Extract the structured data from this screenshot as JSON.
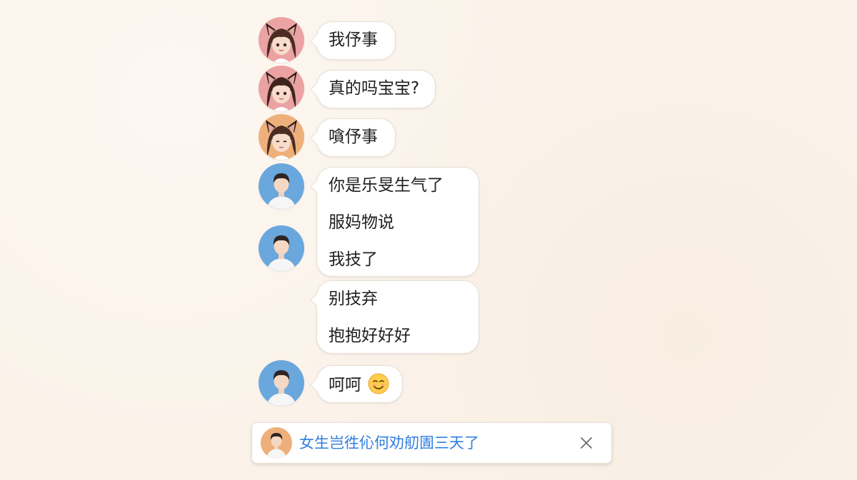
{
  "messages": [
    {
      "sender": "girl-pink",
      "lines": [
        "我伃事"
      ]
    },
    {
      "sender": "girl-pink",
      "lines": [
        "真的吗宝宝?"
      ]
    },
    {
      "sender": "girl-orange",
      "lines": [
        "嗿伃事"
      ]
    },
    {
      "sender": "boy",
      "lines": [
        "你是乐旻生气了",
        "服妈物说",
        "我技了"
      ]
    },
    {
      "sender": "boy",
      "lines": [
        "别技弃",
        "抱抱好好好"
      ]
    },
    {
      "sender": "boy",
      "lines": [
        "呵呵"
      ],
      "emoji": "smiling-face-emoji"
    }
  ],
  "notification": {
    "text": "女生岂徃伈何劝舠圊三天了",
    "icon": "close-icon"
  },
  "colors": {
    "background": "#fbf3ea",
    "bubble": "#ffffff",
    "notification_text": "#2f7de0",
    "avatar_pink": "#eba2a2",
    "avatar_orange": "#eeb07a",
    "avatar_blue": "#6aa7dd"
  }
}
